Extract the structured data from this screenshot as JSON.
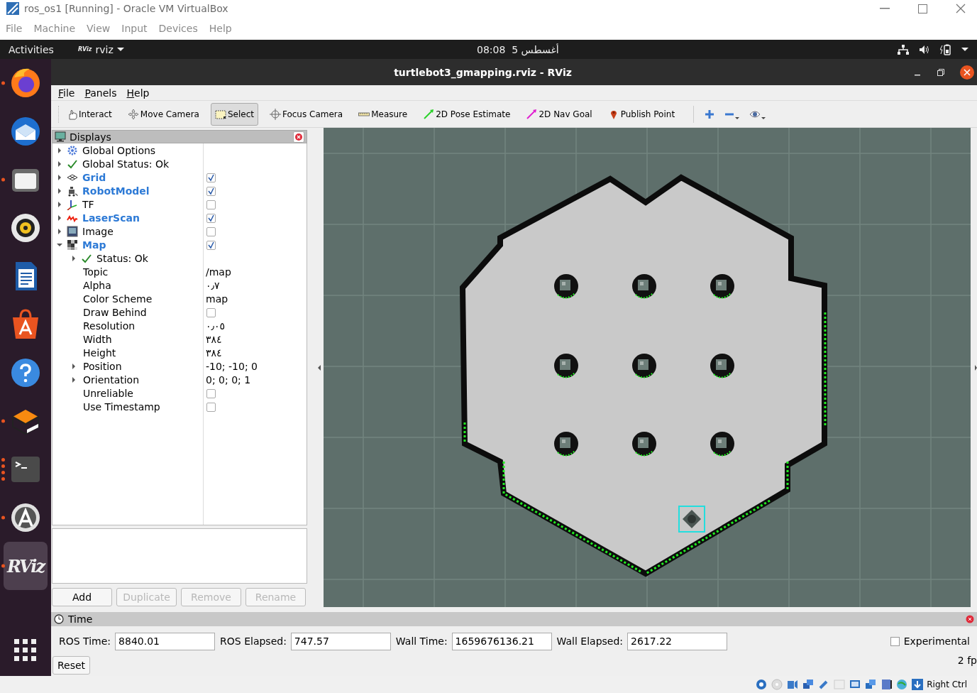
{
  "vbox": {
    "title": "ros_os1 [Running] - Oracle VM VirtualBox",
    "menu": [
      "File",
      "Machine",
      "View",
      "Input",
      "Devices",
      "Help"
    ]
  },
  "topbar": {
    "activities": "Activities",
    "app_logo": "RViz",
    "app": "rviz",
    "clock": "08:08  5 أغسطس"
  },
  "dock": [
    {
      "running": true,
      "selected": false
    },
    {
      "running": false,
      "selected": false
    },
    {
      "running": true,
      "selected": false
    },
    {
      "running": false,
      "selected": false
    },
    {
      "running": false,
      "selected": false
    },
    {
      "running": false,
      "selected": false
    },
    {
      "running": false,
      "selected": false
    },
    {
      "running": true,
      "selected": false
    },
    {
      "running": true,
      "multiple": true,
      "selected": false
    },
    {
      "running": true,
      "selected": false
    },
    {
      "label": "RViz",
      "running": true,
      "selected": true
    }
  ],
  "rviz": {
    "title": "turtlebot3_gmapping.rviz - RViz",
    "menu": [
      "File",
      "Panels",
      "Help"
    ],
    "tools": [
      {
        "label": "Interact",
        "selected": false
      },
      {
        "label": "Move Camera",
        "selected": false
      },
      {
        "label": "Select",
        "selected": true
      },
      {
        "label": "Focus Camera",
        "selected": false
      },
      {
        "label": "Measure",
        "selected": false
      },
      {
        "label": "2D Pose Estimate",
        "selected": false
      },
      {
        "label": "2D Nav Goal",
        "selected": false
      },
      {
        "label": "Publish Point",
        "selected": false
      }
    ],
    "displays": {
      "title": "Displays",
      "items": [
        {
          "kind": "options",
          "label": "Global Options",
          "expanded": false
        },
        {
          "kind": "status",
          "label": "Global Status: Ok",
          "expanded": false
        },
        {
          "kind": "display",
          "label": "Grid",
          "checked": true,
          "expanded": false
        },
        {
          "kind": "display",
          "label": "RobotModel",
          "checked": true,
          "expanded": false
        },
        {
          "kind": "display",
          "label": "TF",
          "checked": false,
          "expanded": false
        },
        {
          "kind": "display",
          "label": "LaserScan",
          "checked": true,
          "expanded": false
        },
        {
          "kind": "display",
          "label": "Image",
          "checked": false,
          "expanded": false
        },
        {
          "kind": "display",
          "label": "Map",
          "checked": true,
          "expanded": true,
          "children": [
            {
              "kind": "status",
              "label": "Status: Ok",
              "expanded": false
            },
            {
              "kind": "property",
              "label": "Topic",
              "value": "/map"
            },
            {
              "kind": "property",
              "label": "Alpha",
              "value": "٠٫٧"
            },
            {
              "kind": "property",
              "label": "Color Scheme",
              "value": "map"
            },
            {
              "kind": "flag",
              "label": "Draw Behind",
              "checked": false
            },
            {
              "kind": "property",
              "label": "Resolution",
              "value": "٠٫٠٥"
            },
            {
              "kind": "property",
              "label": "Width",
              "value": "٣٨٤"
            },
            {
              "kind": "property",
              "label": "Height",
              "value": "٣٨٤"
            },
            {
              "kind": "property",
              "label": "Position",
              "value": "-10; -10; 0",
              "expanded": false
            },
            {
              "kind": "property",
              "label": "Orientation",
              "value": "0; 0; 0; 1",
              "expanded": false
            },
            {
              "kind": "flag",
              "label": "Unreliable",
              "checked": false
            },
            {
              "kind": "flag",
              "label": "Use Timestamp",
              "checked": false
            }
          ]
        }
      ]
    },
    "buttons": [
      {
        "label": "Add",
        "disabled": false
      },
      {
        "label": "Duplicate",
        "disabled": true
      },
      {
        "label": "Remove",
        "disabled": true
      },
      {
        "label": "Rename",
        "disabled": true
      }
    ],
    "time": {
      "title": "Time",
      "fields": [
        {
          "label": "ROS Time:",
          "value": "8840.01"
        },
        {
          "label": "ROS Elapsed:",
          "value": "747.57"
        },
        {
          "label": "Wall Time:",
          "value": "1659676136.21"
        },
        {
          "label": "Wall Elapsed:",
          "value": "2617.22"
        }
      ],
      "experimental": {
        "label": "Experimental",
        "checked": false
      },
      "reset": "Reset",
      "fps": "2 fp"
    }
  },
  "vbox_status": {
    "host_key": "Right Ctrl"
  }
}
